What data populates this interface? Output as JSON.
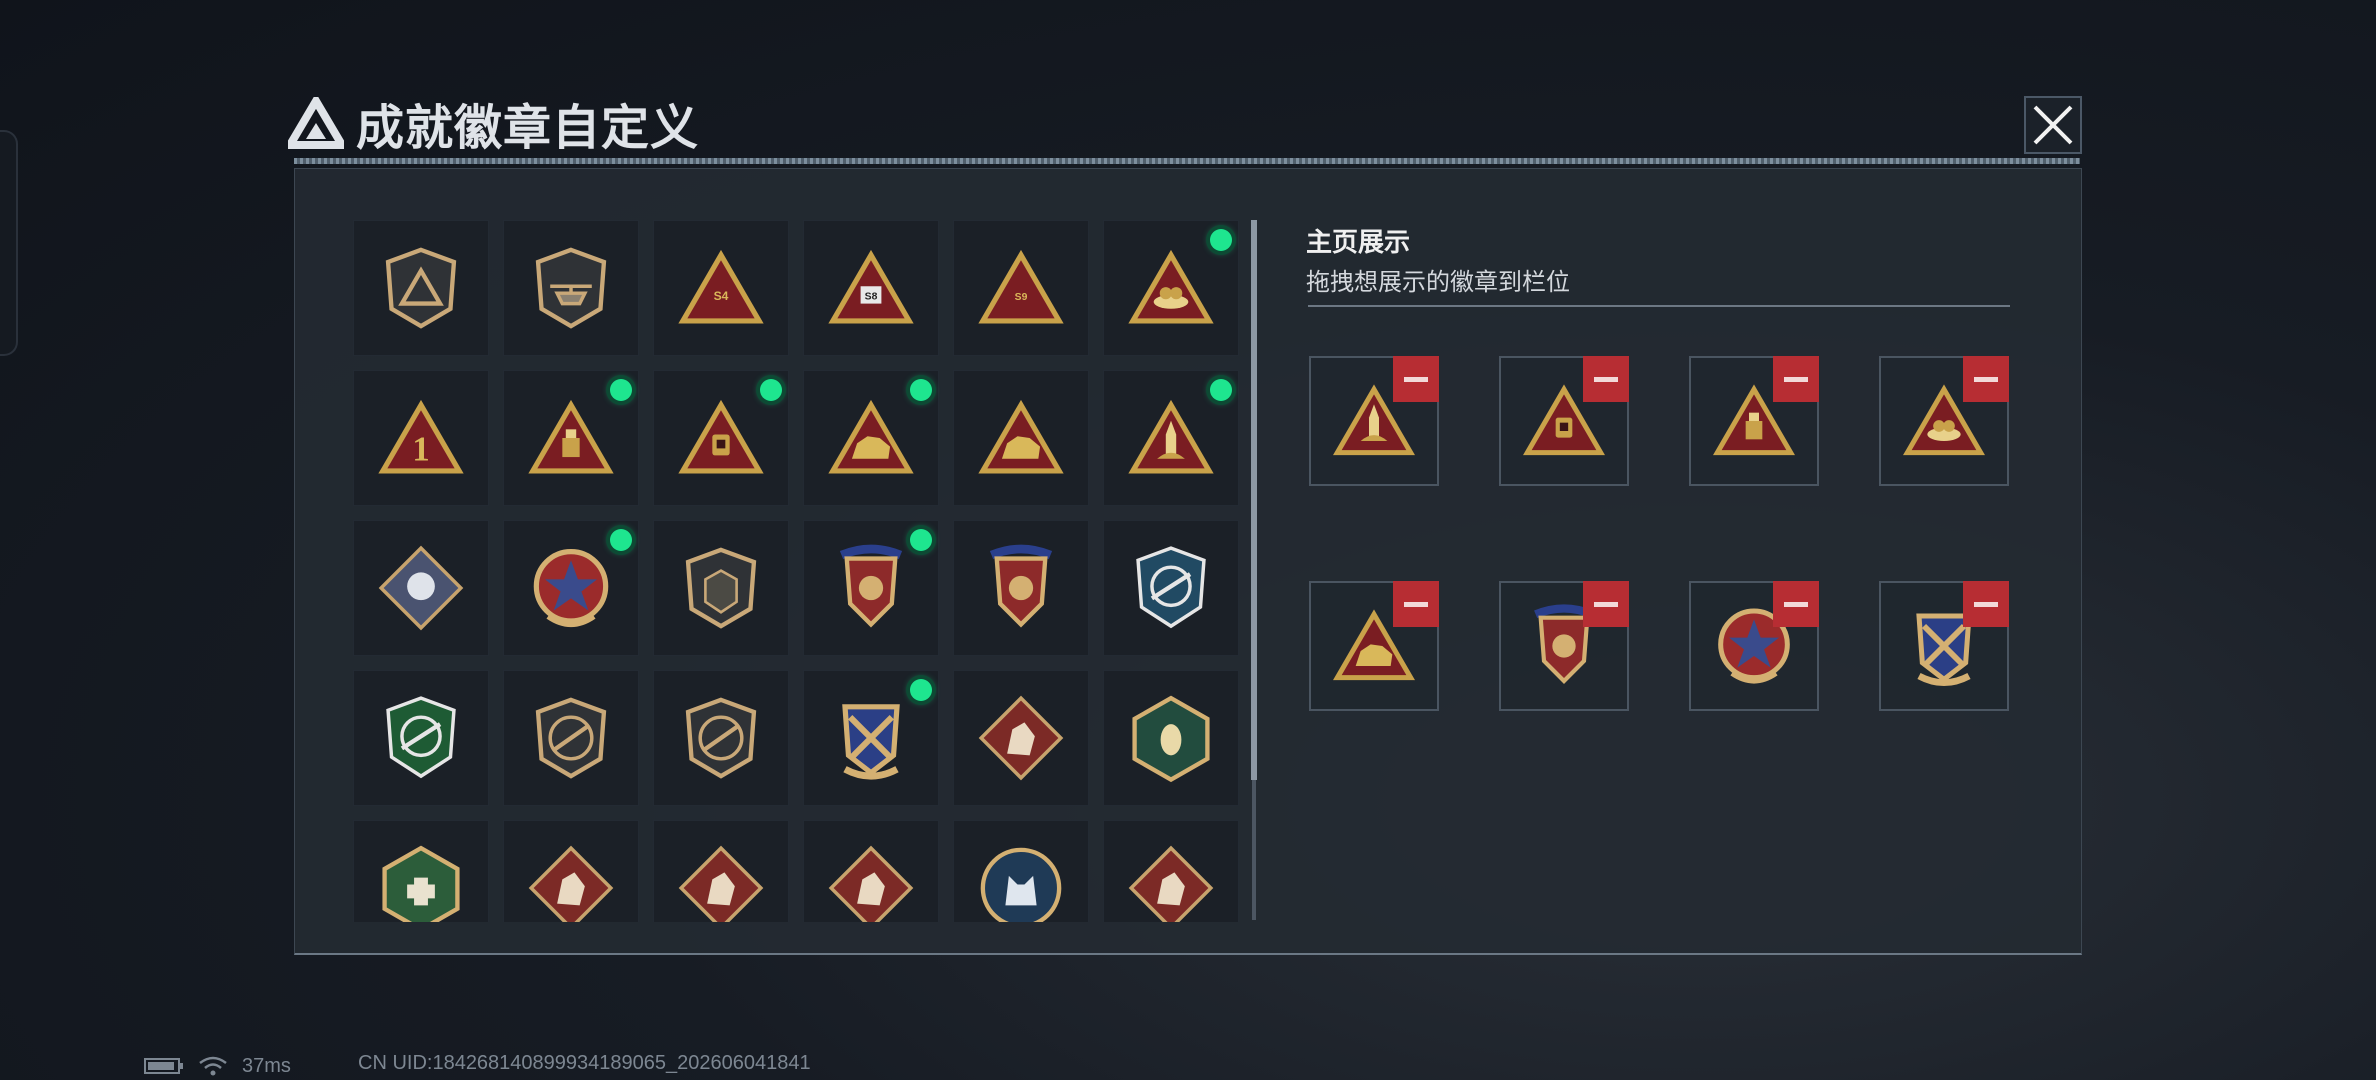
{
  "window": {
    "title": "成就徽章自定义"
  },
  "showcase": {
    "title": "主页展示",
    "subtitle": "拖拽想展示的徽章到栏位"
  },
  "badges": [
    {
      "icon": "shield-triangle-emblem-icon",
      "equipped": false
    },
    {
      "icon": "shield-helicopter-icon",
      "equipped": false
    },
    {
      "icon": "triangle-s4-icon",
      "equipped": false
    },
    {
      "icon": "triangle-s8-icon",
      "equipped": false
    },
    {
      "icon": "triangle-s9-icon",
      "equipped": false
    },
    {
      "icon": "triangle-nest-icon",
      "equipped": true
    },
    {
      "icon": "triangle-number-one-icon",
      "equipped": false
    },
    {
      "icon": "triangle-usb-icon",
      "equipped": true
    },
    {
      "icon": "triangle-chip-icon",
      "equipped": true
    },
    {
      "icon": "triangle-rhino-icon",
      "equipped": true
    },
    {
      "icon": "triangle-beast-icon",
      "equipped": false
    },
    {
      "icon": "triangle-rocket-icon",
      "equipped": true
    },
    {
      "icon": "diamond-rose-icon",
      "equipped": false
    },
    {
      "icon": "round-star-badge-icon",
      "equipped": true
    },
    {
      "icon": "shield-chevron-icon",
      "equipped": false
    },
    {
      "icon": "crest-eagle-icon",
      "equipped": true
    },
    {
      "icon": "crest-dice-icon",
      "equipped": false
    },
    {
      "icon": "blue-target-rifle-icon",
      "equipped": false
    },
    {
      "icon": "green-target-rifle-icon",
      "equipped": false
    },
    {
      "icon": "shield-rifle-icon",
      "equipped": false
    },
    {
      "icon": "shield-pistol-icon",
      "equipped": false
    },
    {
      "icon": "gold-crossed-rifle-icon",
      "equipped": true
    },
    {
      "icon": "diamond-wolf-icon",
      "equipped": false
    },
    {
      "icon": "hexagon-hornet-icon",
      "equipped": false
    },
    {
      "icon": "hexagon-medkit-icon",
      "equipped": false
    },
    {
      "icon": "diamond-dragon-icon",
      "equipped": false
    },
    {
      "icon": "diamond-dragon-roar-icon",
      "equipped": false
    },
    {
      "icon": "diamond-runner-icon",
      "equipped": false
    },
    {
      "icon": "round-wolf-icon",
      "equipped": false
    },
    {
      "icon": "diamond-horse-icon",
      "equipped": false
    }
  ],
  "showcase_slots": [
    {
      "icon": "triangle-rocket-icon"
    },
    {
      "icon": "triangle-chip-icon"
    },
    {
      "icon": "triangle-usb-icon"
    },
    {
      "icon": "triangle-nest-icon"
    },
    {
      "icon": "triangle-rhino-icon"
    },
    {
      "icon": "crest-eagle-icon"
    },
    {
      "icon": "round-star-badge-icon"
    },
    {
      "icon": "gold-crossed-rifle-icon"
    }
  ],
  "status_bar": {
    "ping": "37ms",
    "uid": "CN UID:184268140899934189065_202606041841"
  },
  "colors": {
    "equipped_dot": "#1ee58f",
    "remove_button": "#b72d33",
    "gold": "#c9a24a",
    "badge_red": "#7a1d22"
  }
}
